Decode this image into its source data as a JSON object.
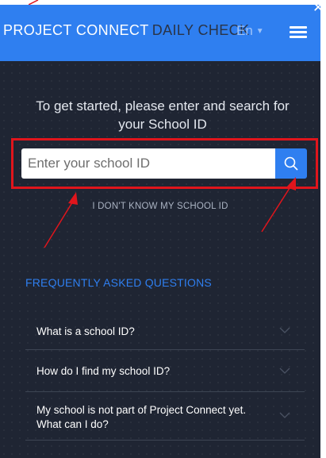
{
  "header": {
    "brand_primary": "PROJECT CONNECT",
    "brand_secondary": "DAILY CHECK",
    "language": "En",
    "menu_icon": "hamburger-menu-icon",
    "close_icon": "close-icon"
  },
  "search": {
    "intro": "To get started, please enter and search for your School ID",
    "placeholder": "Enter your school ID",
    "button_icon": "search-icon",
    "dont_know_link": "I DON'T KNOW MY SCHOOL ID"
  },
  "faq": {
    "heading": "FREQUENTLY ASKED QUESTIONS",
    "items": [
      {
        "question": "What is a school ID?"
      },
      {
        "question": "How do I find my school ID?"
      },
      {
        "question": "My school is not part of Project Connect yet. What can I do?"
      }
    ]
  },
  "colors": {
    "accent": "#2f7ff0",
    "background": "#1f2533",
    "annotation": "#e0151c",
    "brand_secondary": "#2a3447"
  }
}
